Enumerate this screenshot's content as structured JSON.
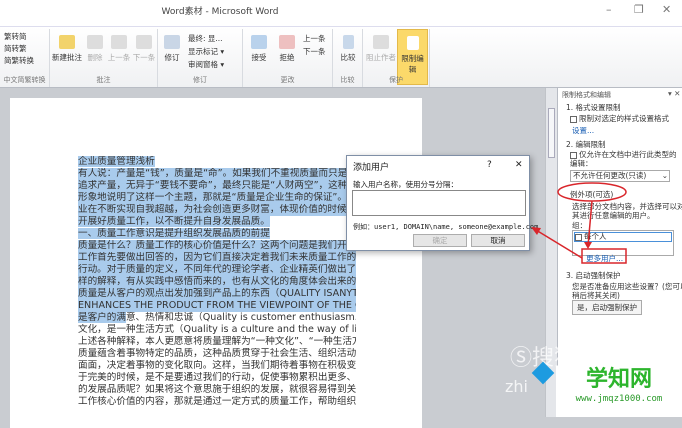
{
  "window": {
    "title": "Word素材 - Microsoft Word",
    "minimize": "–",
    "restore": "❐",
    "close": "✕"
  },
  "ribbon": {
    "chinese": {
      "label": "中文简繁转换",
      "items": [
        "繁转简",
        "简转繁",
        "简繁转换"
      ]
    },
    "comments": {
      "label": "批注",
      "new": "新建批注",
      "delete": "删除",
      "prev": "上一条",
      "next": "下一条"
    },
    "tracking": {
      "label": "修订",
      "track": "修订",
      "final": "最终: 显...",
      "markup": "显示标记 ▾",
      "pane": "审阅窗格 ▾"
    },
    "changes": {
      "label": "更改",
      "accept": "接受",
      "reject": "拒绝",
      "prev": "上一条",
      "next": "下一条"
    },
    "compare": {
      "label": "比较",
      "compare": "比较"
    },
    "protect": {
      "label": "保护",
      "block": "阻止作者",
      "restrict": "限制编辑"
    }
  },
  "document": {
    "lines": [
      "企业质量管理浅析",
      "有人说：产量是“钱”，质量是“命”。如果我们不重视质量而只是一味地",
      "追求产量，无异于“要钱不要命”，最终只能是“人财两空”，这种说法很",
      "形象地说明了这样一个主题，那就是“质量是企业生命的保证”。而当企",
      "业在不断实现自我超越，为社会创造更多财富，体现价值的时候，更需要",
      "开展好质量工作，以不断提升自身发展品质。",
      "一、质量工作意识是提升组织发展品质的前提",
      "质量是什么？质量工作的核心价值是什么？这两个问题是我们开展质量",
      "工作首先要做出回答的，因为它们直接决定着我们未来质量工作的方向和",
      "行动。对于质量的定义，不同年代的理论学者、企业精英们做出了各种各",
      "样的解释，有从实践中感悟而来的，也有从文化的角度体会出来的，比如：",
      "质量是从客户的观点出发加强到产品上的东西（QUALITY ISANYTHING THAT",
      "ENHANCES THE PRODUCT FROM THE VIEWPOINT OF THE CUSTOMER.）；质量",
      "是客户的满意、热情和忠诚（Quality is customer enthusiasm.）；质量是一种",
      "文化，是一种生活方式（Quality is a culture and the way of life.）等等。对于",
      "上述各种解释，本人更愿意将质量理解为“一种文化”、“一种生活方式”，",
      "质量蕴含着事物特定的品质，这种品质贯穿于社会生活、组织活动的方方",
      "面面，决定着事物的变化取向。这样，当我们期待着事物在积极变化中趋",
      "于完美的时候，是不是要通过我们的行动，促使事物累积出更多、更优秀",
      "的发展品质呢？如果将这个意思施于组织的发展，就很容易得到关于质量",
      "工作核心价值的内容，那就是通过一定方式的质量工作，帮助组织提升发"
    ],
    "partial_highlight": "是客户的满",
    "partial_rest": "意、热情和忠诚（Quality is customer enthusiasm.）；质量是一种"
  },
  "dialog": {
    "title": "添加用户",
    "help": "?",
    "close": "✕",
    "prompt": "输入用户名称，使用分号分隔：",
    "input_value": "",
    "example": "例如：user1, DOMAIN\\name, someone@example.com",
    "ok": "确定",
    "cancel": "取消"
  },
  "pane": {
    "title": "限制格式和编辑",
    "s1": "1. 格式设置限制",
    "s1_check": "限制对选定的样式设置格式",
    "s1_link": "设置...",
    "s2": "2. 编辑限制",
    "s2_check": "仅允许在文档中进行此类型的编辑：",
    "s2_select": "不允许任何更改(只读)",
    "exceptions": "例外项(可选)",
    "exceptions_desc1": "选择部分文档内容，并选择可以对",
    "exceptions_desc2": "其进行任意编辑的用户。",
    "groups": "组：",
    "group_item": "每个人",
    "more_users": "更多用户...",
    "s3": "3. 启动强制保护",
    "s3_desc1": "您是否准备应用这些设置？(您可以",
    "s3_desc2": "稍后将其关闭)",
    "s3_button": "是，启动强制保护"
  },
  "watermarks": {
    "sogou": "搜狗指南",
    "zhi": "zhi",
    "site": "学知网",
    "url": "www.jmqz1000.com"
  },
  "colors": {
    "highlight": "#a9cbec",
    "annotation": "#d9262b",
    "accent": "#fbd96a"
  }
}
